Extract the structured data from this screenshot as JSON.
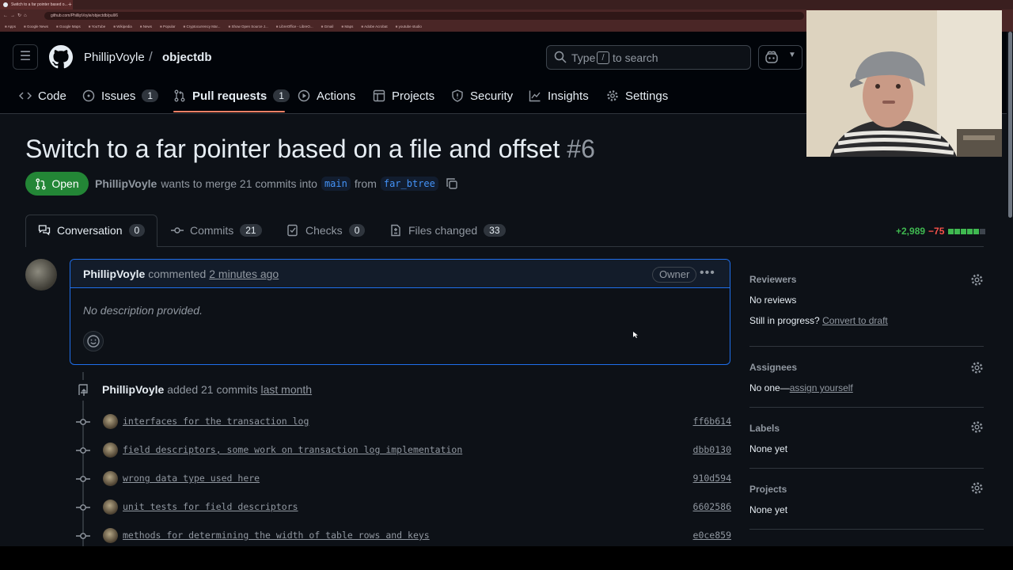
{
  "browser": {
    "tab_title": "Switch to a far pointer based o...",
    "url": "github.com/PhillipVoyle/objectdb/pull/6",
    "bookmarks": [
      "Apps",
      "Google News",
      "Google Maps",
      "YouTube",
      "Wikipedia",
      "News",
      "Popular",
      "Cryptocurrency Mar...",
      "Show Open Source J...",
      "LibreOffice - LibreO...",
      "Gmail",
      "Maps",
      "Adobe Acrobat",
      "youtube studio"
    ]
  },
  "header": {
    "owner": "PhillipVoyle",
    "separator": "/",
    "repo": "objectdb",
    "search_prefix": "Type",
    "search_key": "/",
    "search_suffix": "to search"
  },
  "repo_tabs": [
    {
      "label": "Code",
      "count": null,
      "icon": "code-icon"
    },
    {
      "label": "Issues",
      "count": "1",
      "icon": "issue-opened-icon"
    },
    {
      "label": "Pull requests",
      "count": "1",
      "icon": "git-pull-request-icon",
      "selected": true
    },
    {
      "label": "Actions",
      "count": null,
      "icon": "play-icon"
    },
    {
      "label": "Projects",
      "count": null,
      "icon": "table-icon"
    },
    {
      "label": "Security",
      "count": null,
      "icon": "shield-icon"
    },
    {
      "label": "Insights",
      "count": null,
      "icon": "graph-icon"
    },
    {
      "label": "Settings",
      "count": null,
      "icon": "gear-icon"
    }
  ],
  "pr": {
    "title": "Switch to a far pointer based on a file and offset",
    "number": "#6",
    "state": "Open",
    "author": "PhillipVoyle",
    "merge_text": "wants to merge 21 commits into",
    "base_branch": "main",
    "from_text": "from",
    "head_branch": "far_btree"
  },
  "pr_tabs": [
    {
      "label": "Conversation",
      "count": "0",
      "icon": "comment-discussion-icon"
    },
    {
      "label": "Commits",
      "count": "21",
      "icon": "git-commit-icon"
    },
    {
      "label": "Checks",
      "count": "0",
      "icon": "checklist-icon"
    },
    {
      "label": "Files changed",
      "count": "33",
      "icon": "file-diff-icon"
    }
  ],
  "diffstat": {
    "additions": "+2,989",
    "deletions": "−75",
    "boxes": [
      "add",
      "add",
      "add",
      "add",
      "add",
      "neutral"
    ]
  },
  "comment": {
    "author": "PhillipVoyle",
    "action": "commented",
    "time": "2 minutes ago",
    "badge": "Owner",
    "body": "No description provided."
  },
  "push_event": {
    "author": "PhillipVoyle",
    "text": "added 21 commits",
    "time": "last month"
  },
  "commits": [
    {
      "message": "interfaces for the transaction log",
      "sha": "ff6b614"
    },
    {
      "message": "field descriptors, some work on transaction log implementation",
      "sha": "dbb0130"
    },
    {
      "message": "wrong data type used here",
      "sha": "910d594"
    },
    {
      "message": "unit tests for field descriptors",
      "sha": "6602586"
    },
    {
      "message": "methods for determining the width of table rows and keys",
      "sha": "e0ce859"
    }
  ],
  "sidebar": {
    "reviewers": {
      "heading": "Reviewers",
      "value": "No reviews",
      "extra_prefix": "Still in progress?",
      "extra_link": "Convert to draft"
    },
    "assignees": {
      "heading": "Assignees",
      "value_prefix": "No one—",
      "value_link": "assign yourself"
    },
    "labels": {
      "heading": "Labels",
      "value": "None yet"
    },
    "projects": {
      "heading": "Projects",
      "value": "None yet"
    }
  },
  "colors": {
    "background": "#0d1117",
    "header_bg": "#010409",
    "accent_blue": "#1f6feb",
    "open_green": "#238636",
    "tab_underline": "#f78166",
    "additions": "#3fb950",
    "deletions": "#f85149"
  }
}
